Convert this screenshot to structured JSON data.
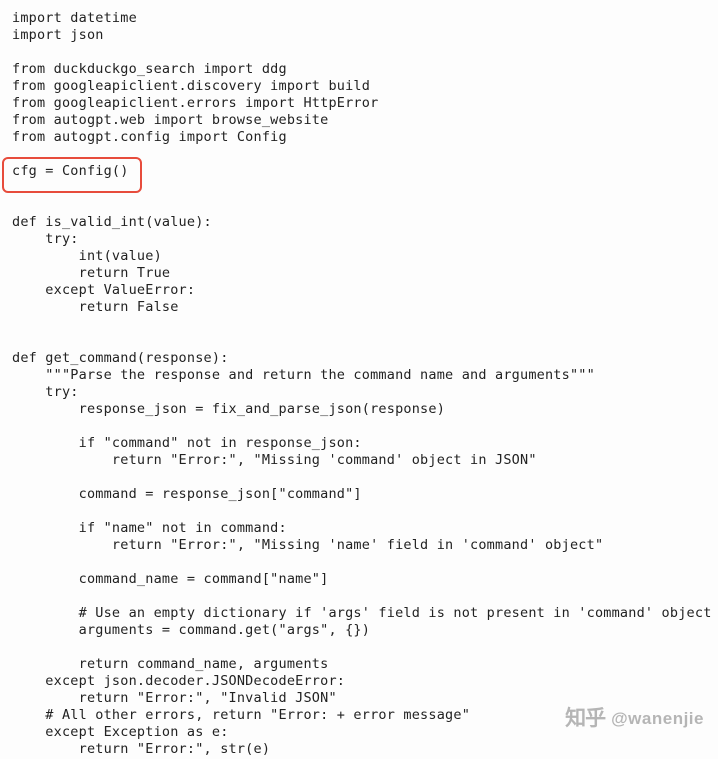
{
  "code": {
    "line1": "import datetime",
    "line2": "import json",
    "line3": "",
    "line4": "from duckduckgo_search import ddg",
    "line5": "from googleapiclient.discovery import build",
    "line6": "from googleapiclient.errors import HttpError",
    "line7": "from autogpt.web import browse_website",
    "line8": "from autogpt.config import Config",
    "line9": "",
    "line10": "cfg = Config()",
    "line11": "",
    "line12": "",
    "line13": "def is_valid_int(value):",
    "line14": "    try:",
    "line15": "        int(value)",
    "line16": "        return True",
    "line17": "    except ValueError:",
    "line18": "        return False",
    "line19": "",
    "line20": "",
    "line21": "def get_command(response):",
    "line22": "    \"\"\"Parse the response and return the command name and arguments\"\"\"",
    "line23": "    try:",
    "line24": "        response_json = fix_and_parse_json(response)",
    "line25": "",
    "line26": "        if \"command\" not in response_json:",
    "line27": "            return \"Error:\", \"Missing 'command' object in JSON\"",
    "line28": "",
    "line29": "        command = response_json[\"command\"]",
    "line30": "",
    "line31": "        if \"name\" not in command:",
    "line32": "            return \"Error:\", \"Missing 'name' field in 'command' object\"",
    "line33": "",
    "line34": "        command_name = command[\"name\"]",
    "line35": "",
    "line36": "        # Use an empty dictionary if 'args' field is not present in 'command' object",
    "line37": "        arguments = command.get(\"args\", {})",
    "line38": "",
    "line39": "        return command_name, arguments",
    "line40": "    except json.decoder.JSONDecodeError:",
    "line41": "        return \"Error:\", \"Invalid JSON\"",
    "line42": "    # All other errors, return \"Error: + error message\"",
    "line43": "    except Exception as e:",
    "line44": "        return \"Error:\", str(e)"
  },
  "watermark": {
    "logo": "知乎",
    "handle": "@wanenjie"
  }
}
